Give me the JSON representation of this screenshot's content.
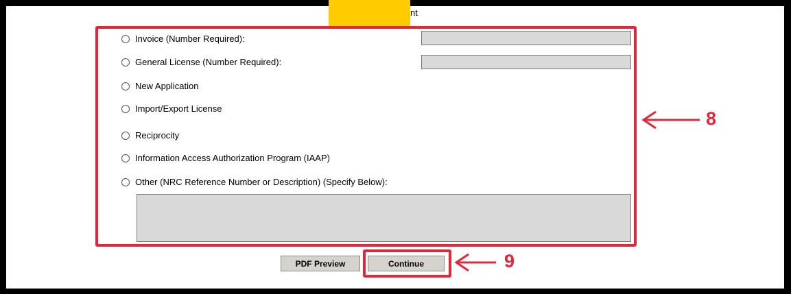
{
  "header": {
    "title_fragment": "nt"
  },
  "options": [
    {
      "label": "Invoice (Number Required):"
    },
    {
      "label": "General License (Number Required):"
    },
    {
      "label": "New Application"
    },
    {
      "label": "Import/Export License"
    },
    {
      "label": "Reciprocity"
    },
    {
      "label": "Information Access Authorization Program (IAAP)"
    },
    {
      "label": "Other (NRC Reference Number or Description) (Specify Below):"
    }
  ],
  "buttons": {
    "pdf_preview": "PDF Preview",
    "continue": "Continue"
  },
  "callouts": {
    "options_box": "8",
    "continue_box": "9"
  },
  "colors": {
    "highlight": "#e0283a",
    "field": "#d9d9d9",
    "accent_tab": "#ffcc00"
  }
}
